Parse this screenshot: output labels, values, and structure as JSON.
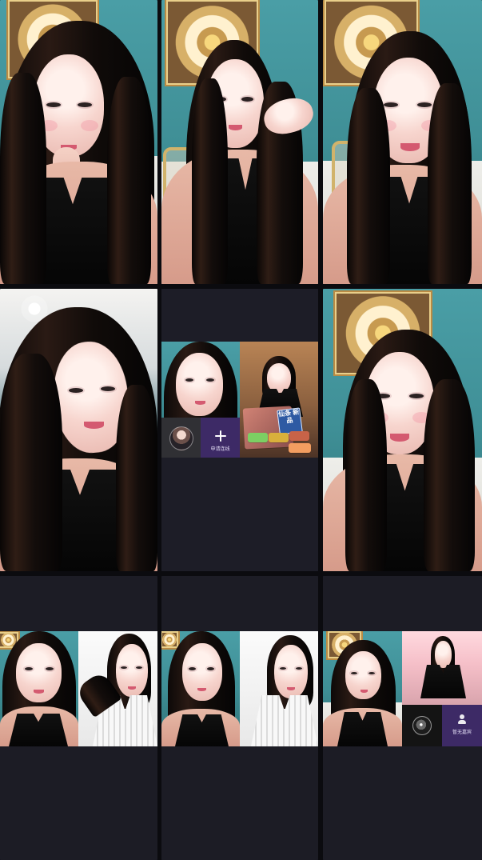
{
  "screen": {
    "title": "",
    "background": "#0b0b0f",
    "tile_background": "#1d1d26",
    "accent_panel": "#3d2a66"
  },
  "grid": {
    "tiles": [
      {
        "name": "stream-tile-1",
        "content": "video"
      },
      {
        "name": "stream-tile-2",
        "content": "video"
      },
      {
        "name": "stream-tile-3",
        "content": "video"
      },
      {
        "name": "stream-tile-4",
        "content": "video"
      },
      {
        "name": "stream-tile-5",
        "content": "mini-link-panel"
      },
      {
        "name": "stream-tile-6",
        "content": "video"
      },
      {
        "name": "stream-tile-7",
        "content": "split-video"
      },
      {
        "name": "stream-tile-8",
        "content": "split-video"
      },
      {
        "name": "stream-tile-9",
        "content": "split-video-with-panels"
      }
    ]
  },
  "center_panel": {
    "apply_label": "申请连线",
    "product_label": "仙条\n新品",
    "plus_icon": "plus-icon"
  },
  "bottom_right_panel": {
    "seat_label": "暂无嘉宾",
    "camera_icon": "camera-icon",
    "seat_icon": "user-icon"
  }
}
